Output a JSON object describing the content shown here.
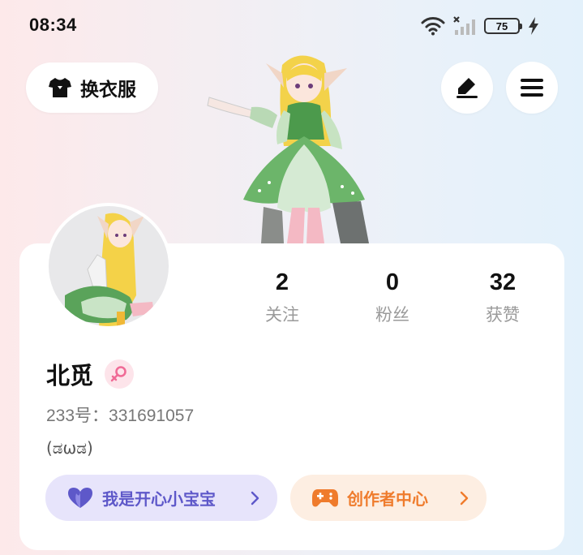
{
  "status_bar": {
    "time": "08:34",
    "battery": "75",
    "icons": [
      "wifi-icon",
      "no-signal-icon",
      "battery-icon",
      "charging-icon"
    ]
  },
  "header": {
    "outfit_button_label": "换衣服",
    "outfit_icon": "tshirt-icon",
    "edit_icon": "edit-pen-icon",
    "menu_icon": "hamburger-menu-icon"
  },
  "profile": {
    "username": "北觅",
    "gender": "female",
    "id_text": "233号：331691057",
    "bio": "(ಡωಡ)"
  },
  "stats": [
    {
      "value": "2",
      "label": "关注"
    },
    {
      "value": "0",
      "label": "粉丝"
    },
    {
      "value": "32",
      "label": "获赞"
    }
  ],
  "actions": {
    "happy": {
      "label": "我是开心小宝宝",
      "icon": "heart-icon"
    },
    "creator": {
      "label": "创作者中心",
      "icon": "gamepad-icon"
    }
  },
  "colors": {
    "happy_accent": "#5e58c9",
    "happy_bg": "#e7e4fb",
    "creator_accent": "#ef7b2c",
    "creator_bg": "#fdeee2",
    "gender_pink": "#f06b96"
  }
}
